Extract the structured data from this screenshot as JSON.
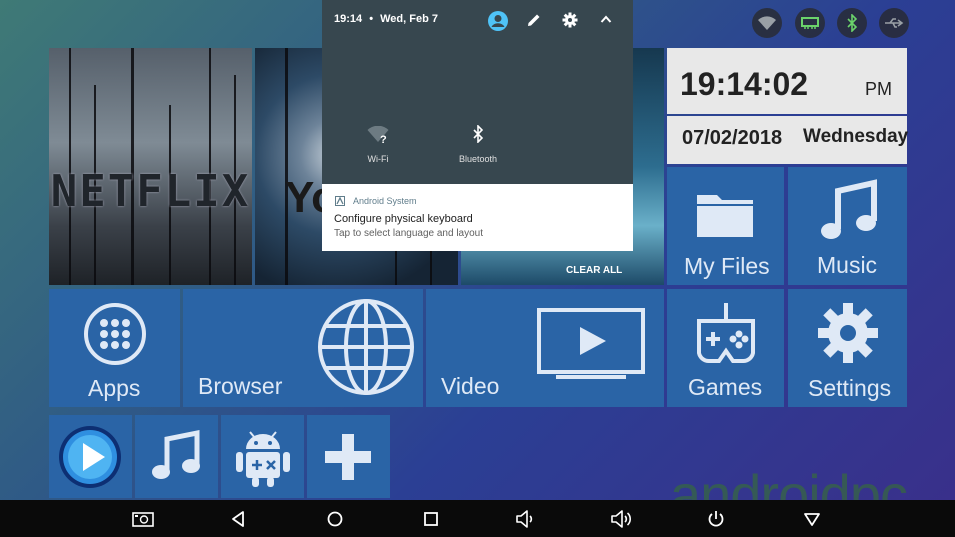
{
  "notification_shade": {
    "time": "19:14",
    "separator": "•",
    "date": "Wed, Feb 7",
    "quick_settings": [
      {
        "label": "Wi-Fi",
        "icon": "wifi-unknown-icon"
      },
      {
        "label": "Bluetooth",
        "icon": "bluetooth-icon"
      }
    ],
    "notification": {
      "app": "Android System",
      "title": "Configure physical keyboard",
      "text": "Tap to select language and layout"
    },
    "clear_all": "CLEAR ALL"
  },
  "launcher": {
    "netflix_text": "NETFLIX",
    "youtube_text": "Yo",
    "clock": {
      "time": "19:14:02",
      "ampm": "PM",
      "date": "07/02/2018",
      "day": "Wednesday"
    },
    "tiles": {
      "my_files": "My Files",
      "music": "Music",
      "apps": "Apps",
      "browser": "Browser",
      "video": "Video",
      "games": "Games",
      "settings": "Settings"
    }
  },
  "watermark": "androidpc",
  "colors": {
    "tile": "#2a64a6",
    "shade": "#37474f",
    "accent": "#4fc3f7",
    "navbar": "#0a0a0a"
  }
}
